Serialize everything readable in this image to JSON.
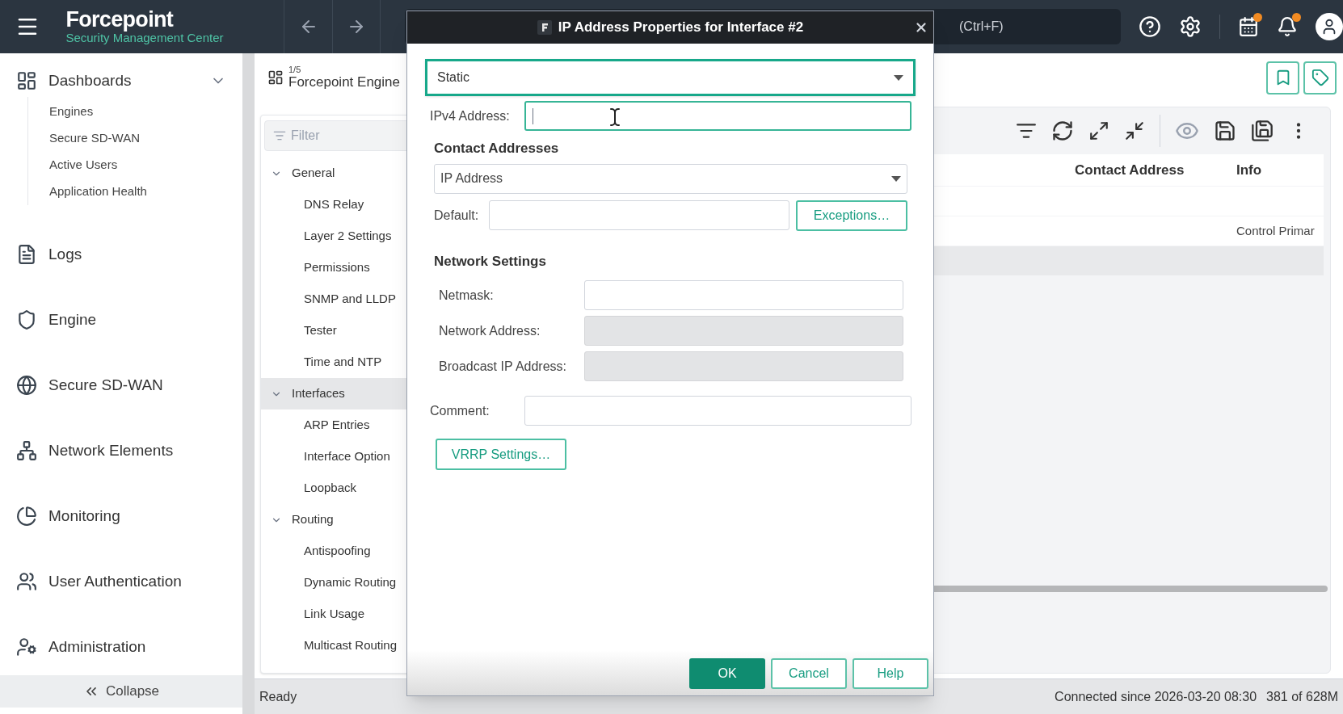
{
  "top_bar": {
    "brand": "Forcepoint",
    "subtitle": "Security Management Center",
    "search_hint": "(Ctrl+F)",
    "notifications": [
      {
        "badge": true
      },
      {
        "badge": true
      }
    ]
  },
  "sidebar": {
    "items": [
      {
        "label": "Dashboards",
        "expanded": true,
        "children": [
          {
            "label": "Engines"
          },
          {
            "label": "Secure SD-WAN"
          },
          {
            "label": "Active Users"
          },
          {
            "label": "Application Health"
          }
        ]
      },
      {
        "label": "Logs"
      },
      {
        "label": "Engine"
      },
      {
        "label": "Secure SD-WAN"
      },
      {
        "label": "Network Elements"
      },
      {
        "label": "Monitoring"
      },
      {
        "label": "User Authentication"
      },
      {
        "label": "Administration"
      }
    ],
    "collapse": "Collapse"
  },
  "tree_panel": {
    "counter": "1/5",
    "title": "Forcepoint Engine",
    "filter_placeholder": "Filter",
    "nodes": [
      {
        "label": "General",
        "expanded": true,
        "selected": false,
        "children": [
          {
            "label": "DNS Relay",
            "selected": false
          },
          {
            "label": "Layer 2 Settings",
            "selected": false
          },
          {
            "label": "Permissions",
            "selected": false
          },
          {
            "label": "SNMP and LLDP",
            "selected": false
          },
          {
            "label": "Tester",
            "selected": false
          },
          {
            "label": "Time and NTP",
            "selected": false
          }
        ]
      },
      {
        "label": "Interfaces",
        "expanded": true,
        "selected": true,
        "children": [
          {
            "label": "ARP Entries",
            "selected": false
          },
          {
            "label": "Interface Option",
            "selected": false
          },
          {
            "label": "Loopback",
            "selected": false
          }
        ]
      },
      {
        "label": "Routing",
        "expanded": true,
        "selected": false,
        "children": [
          {
            "label": "Antispoofing",
            "selected": false
          },
          {
            "label": "Dynamic Routing",
            "selected": false
          },
          {
            "label": "Link Usage",
            "selected": false
          },
          {
            "label": "Multicast Routing",
            "selected": false
          }
        ]
      }
    ]
  },
  "content": {
    "columns": [
      "Contact Address",
      "Info"
    ],
    "rows": [
      {
        "selected": false
      },
      {
        "info": "Control Primar",
        "selected": false
      },
      {
        "selected": true
      }
    ]
  },
  "status_bar": {
    "left": "Ready",
    "connection": "Connected since 2026-03-20 08:30",
    "memory": "381 of 628M"
  },
  "dialog": {
    "title": "IP Address Properties for Interface #2",
    "type_select": {
      "value": "Static",
      "highlighted": true
    },
    "ipv4": {
      "label": "IPv4 Address:",
      "focused": true
    },
    "contact_heading": "Contact Addresses",
    "contact_select": {
      "value": "IP Address"
    },
    "default_label": "Default:",
    "exceptions_button": "Exceptions…",
    "network_heading": "Network Settings",
    "network_fields": [
      {
        "label": "Netmask:",
        "disabled": false
      },
      {
        "label": "Network Address:",
        "disabled": true
      },
      {
        "label": "Broadcast IP Address:",
        "disabled": true
      }
    ],
    "comment_label": "Comment:",
    "vrrp_button": "VRRP Settings…",
    "buttons": [
      {
        "label": "OK",
        "primary": true
      },
      {
        "label": "Cancel",
        "primary": false
      },
      {
        "label": "Help",
        "primary": false
      }
    ]
  }
}
